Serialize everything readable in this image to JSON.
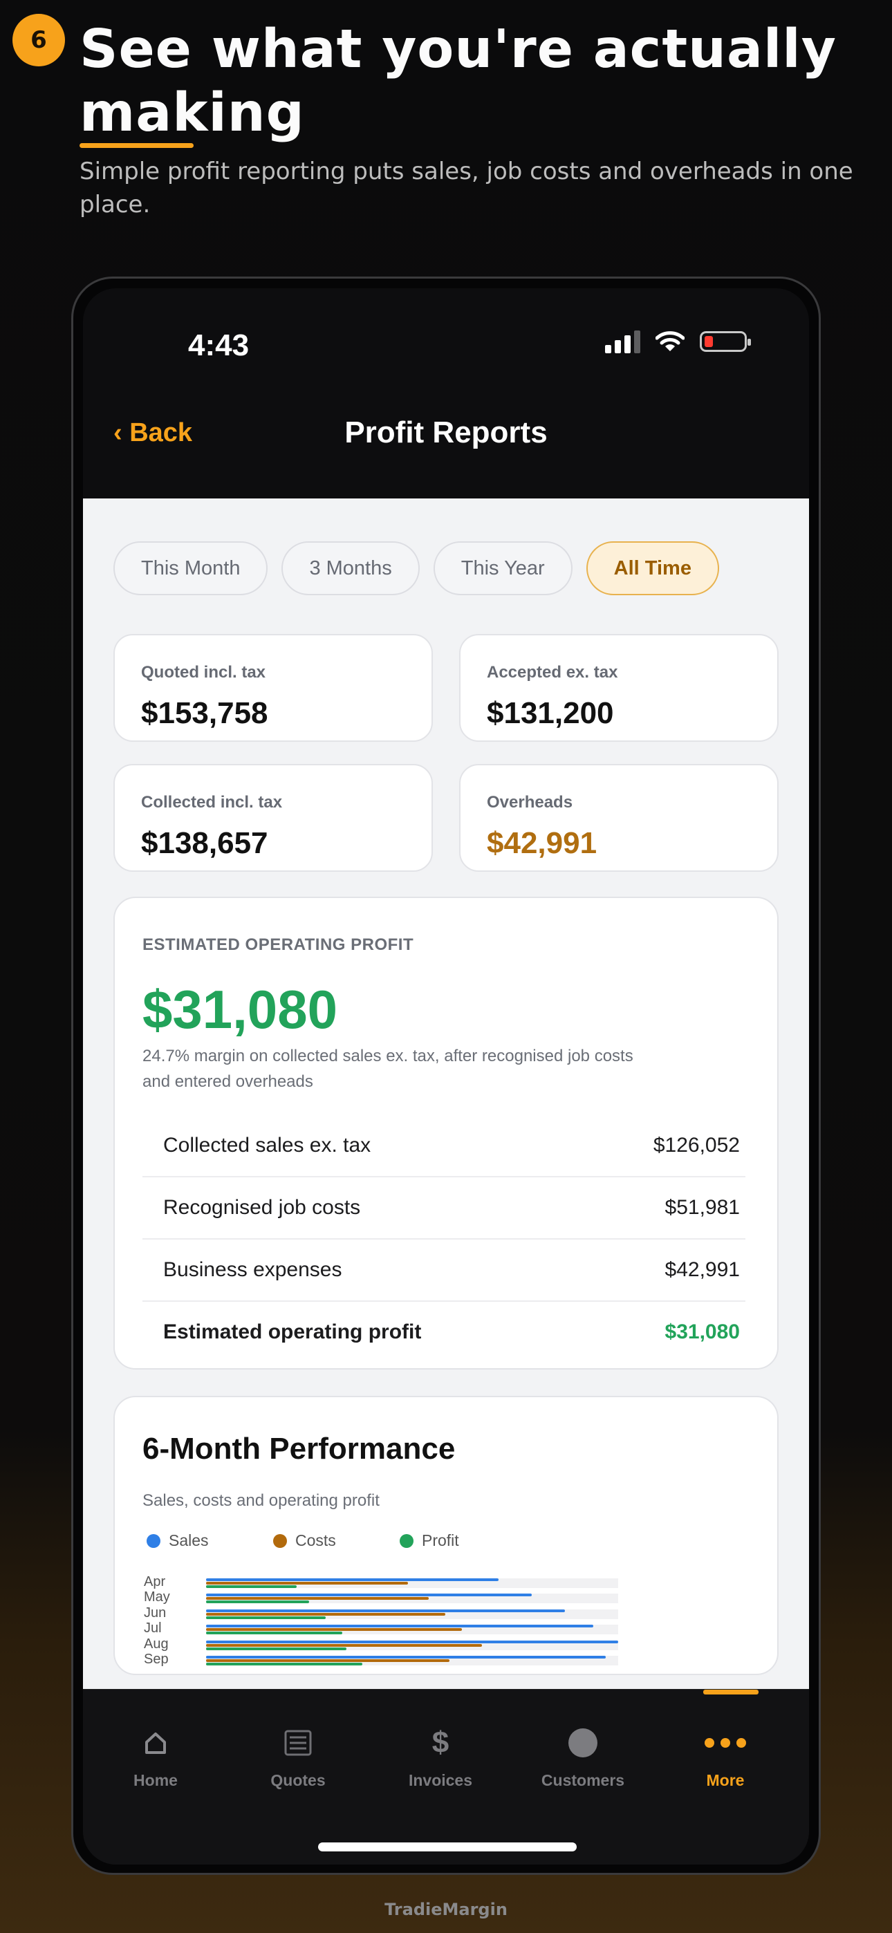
{
  "step_number": "6",
  "headline": {
    "line1": "See what you're actually",
    "line2": "making"
  },
  "subheadline": "Simple profit reporting puts sales, job costs and overheads in one place.",
  "status_bar": {
    "time": "4:43"
  },
  "nav": {
    "back_label": "‹ Back",
    "title": "Profit Reports"
  },
  "filters": [
    {
      "label": "This Month",
      "active": false
    },
    {
      "label": "3 Months",
      "active": false
    },
    {
      "label": "This Year",
      "active": false
    },
    {
      "label": "All Time",
      "active": true
    }
  ],
  "stats": [
    {
      "label": "Quoted incl. tax",
      "value": "$153,758"
    },
    {
      "label": "Accepted ex. tax",
      "value": "$131,200"
    },
    {
      "label": "Collected incl. tax",
      "value": "$138,657"
    },
    {
      "label": "Overheads",
      "value": "$42,991"
    }
  ],
  "profit": {
    "kicker": "ESTIMATED OPERATING PROFIT",
    "amount": "$31,080",
    "note": "24.7% margin on collected sales ex. tax, after recognised job costs and entered overheads",
    "rows": [
      {
        "label": "Collected sales ex. tax",
        "value": "$126,052"
      },
      {
        "label": "Recognised job costs",
        "value": "$51,981"
      },
      {
        "label": "Business expenses",
        "value": "$42,991"
      },
      {
        "label": "Estimated operating profit",
        "value": "$31,080"
      }
    ]
  },
  "performance": {
    "title": "6-Month Performance",
    "subtitle": "Sales, costs and operating profit",
    "legend": {
      "sales": "Sales",
      "costs": "Costs",
      "profit": "Profit"
    }
  },
  "chart_data": {
    "type": "bar",
    "orientation": "horizontal",
    "categories": [
      "Apr",
      "May",
      "Jun",
      "Jul",
      "Aug",
      "Sep"
    ],
    "series": [
      {
        "name": "Sales",
        "values": [
          0.71,
          0.79,
          0.87,
          0.94,
          1.0,
          0.97
        ]
      },
      {
        "name": "Costs",
        "values": [
          0.49,
          0.54,
          0.58,
          0.62,
          0.67,
          0.59
        ]
      },
      {
        "name": "Profit",
        "values": [
          0.22,
          0.25,
          0.29,
          0.33,
          0.34,
          0.38
        ]
      }
    ],
    "colors": {
      "Sales": "#2f7fe6",
      "Costs": "#b26a0c",
      "Profit": "#22a35a"
    },
    "legend": "top-left"
  },
  "tabbar": {
    "items": [
      {
        "label": "Home",
        "icon": "home-icon",
        "active": false
      },
      {
        "label": "Quotes",
        "icon": "quotes-icon",
        "active": false
      },
      {
        "label": "Invoices",
        "icon": "dollar-icon",
        "active": false
      },
      {
        "label": "Customers",
        "icon": "customers-icon",
        "active": false
      },
      {
        "label": "More",
        "icon": "more-icon",
        "active": true
      }
    ]
  },
  "brand": "TradieMargin",
  "colors": {
    "accent": "#f7a21b",
    "profit_green": "#22a35a",
    "overheads_orange": "#b06e10"
  }
}
